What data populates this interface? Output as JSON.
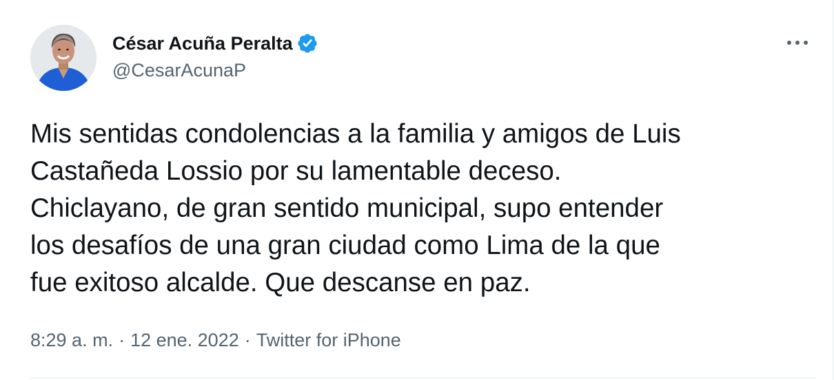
{
  "author": {
    "display_name": "César Acuña Peralta",
    "handle": "@CesarAcunaP",
    "verified": true
  },
  "tweet": {
    "text_lines": [
      "Mis sentidas condolencias a la familia y amigos de Luis",
      "Castañeda Lossio por su lamentable deceso.",
      "Chiclayano, de gran sentido municipal, supo entender",
      "los desafíos de una gran ciudad como Lima de la que",
      "fue exitoso alcalde. Que descanse en paz."
    ],
    "time": "8:29 a. m.",
    "date": "12 ene. 2022",
    "source": "Twitter for iPhone",
    "separator": "·"
  },
  "icons": {
    "more": "more-options-icon",
    "verified": "verified-badge-icon"
  },
  "colors": {
    "text": "#0f1419",
    "secondary": "#536471",
    "verified": "#1d9bf0"
  }
}
